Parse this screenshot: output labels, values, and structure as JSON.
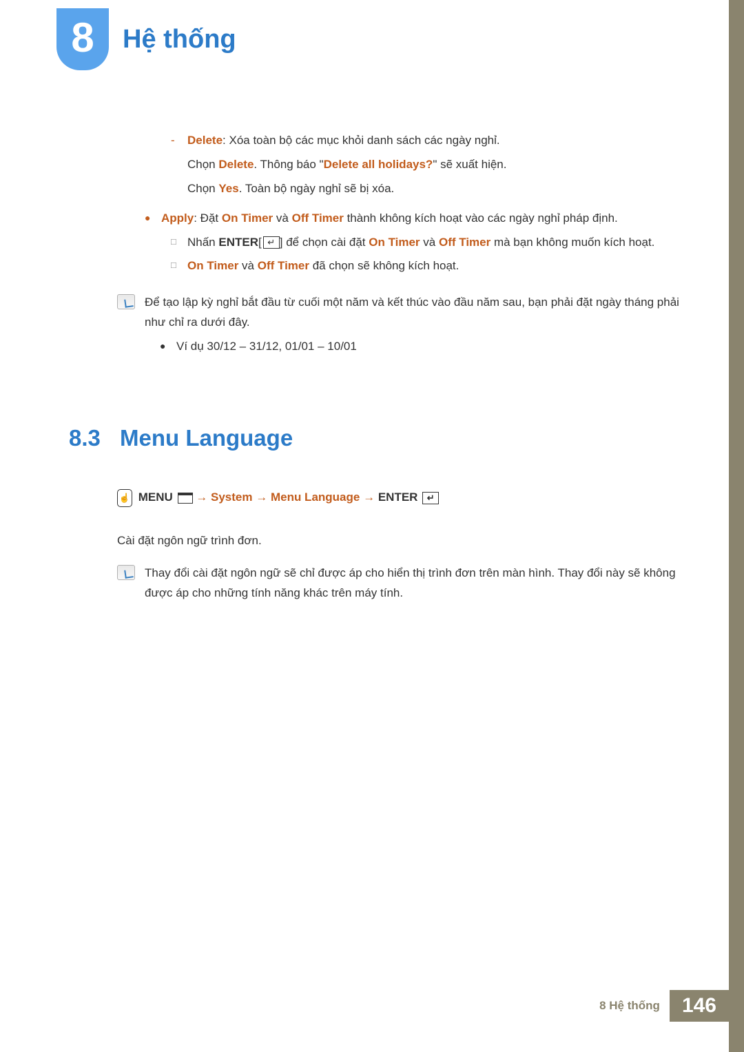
{
  "chapter": {
    "number": "8",
    "title": "Hệ thống"
  },
  "delete_block": {
    "label": "Delete",
    "desc": ": Xóa toàn bộ các mục khỏi danh sách các ngày nghỉ.",
    "line2_pre": "Chọn ",
    "line2_bold1": "Delete",
    "line2_mid": ". Thông báo \"",
    "line2_bold2": "Delete all holidays?",
    "line2_post": "\" sẽ xuất hiện.",
    "line3_pre": "Chọn ",
    "line3_bold": "Yes",
    "line3_post": ". Toàn bộ ngày nghỉ sẽ bị xóa."
  },
  "apply_block": {
    "label": "Apply",
    "pre": ": Đặt ",
    "on_timer": "On Timer",
    "mid1": " và ",
    "off_timer": "Off Timer",
    "post": " thành không kích hoạt vào các ngày nghỉ pháp định.",
    "sq1_pre": "Nhấn ",
    "sq1_enter": "ENTER",
    "sq1_mid1": " để chọn cài đặt ",
    "sq1_mid2": " và ",
    "sq1_post": " mà bạn không muốn kích hoạt.",
    "sq2_mid": " và ",
    "sq2_post": " đã chọn sẽ không kích hoạt."
  },
  "note1": {
    "text": "Để tạo lập kỳ nghỉ bắt đầu từ cuối một năm và kết thúc vào đầu năm sau, bạn phải đặt ngày tháng phải như chỉ ra dưới đây.",
    "example": "Ví dụ 30/12 – 31/12, 01/01 – 10/01"
  },
  "section83": {
    "num": "8.3",
    "title": "Menu Language",
    "nav_menu": "MENU",
    "nav_arrow": " → ",
    "nav_system": "System",
    "nav_menulang": "Menu Language",
    "nav_enter": "ENTER",
    "body": "Cài đặt ngôn ngữ trình đơn.",
    "note": "Thay đổi cài đặt ngôn ngữ sẽ chỉ được áp cho hiển thị trình đơn trên màn hình. Thay đổi này sẽ không được áp cho những tính năng khác trên máy tính."
  },
  "footer": {
    "label": "8 Hệ thống",
    "page": "146"
  }
}
